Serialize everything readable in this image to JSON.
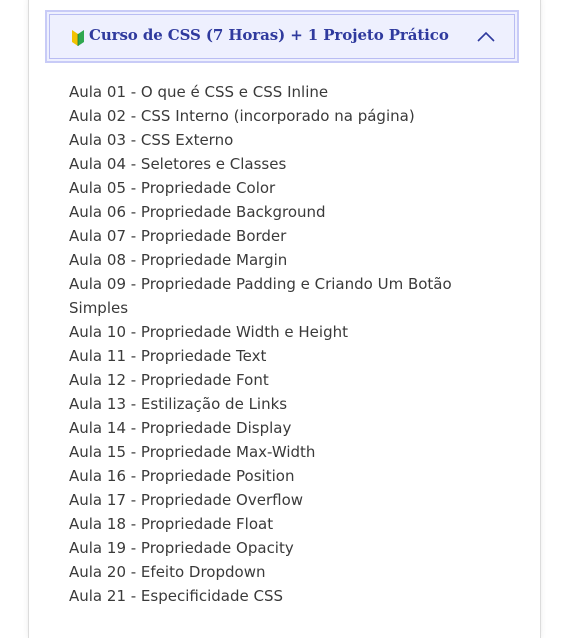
{
  "accordion": {
    "title": "Curso de CSS (7 Horas) + 1 Projeto Prático",
    "icon": "beginner-leaf-icon",
    "toggle_icon": "chevron-up-icon",
    "expanded": true,
    "colors": {
      "header_bg": "#eef0fe",
      "header_border": "#c8cbf7",
      "title": "#2f3a9e",
      "text": "#3a3a3a"
    }
  },
  "lessons": [
    "Aula 01 - O que é CSS e CSS Inline",
    "Aula 02 - CSS Interno (incorporado na página)",
    "Aula 03 - CSS Externo",
    "Aula 04 - Seletores e Classes",
    "Aula 05 - Propriedade Color",
    "Aula 06 - Propriedade Background",
    "Aula 07 - Propriedade Border",
    "Aula 08 - Propriedade Margin",
    "Aula 09 - Propriedade Padding e Criando Um Botão Simples",
    "Aula 10 - Propriedade Width e Height",
    "Aula 11 - Propriedade Text",
    "Aula 12 - Propriedade Font",
    "Aula 13 - Estilização de Links",
    "Aula 14 - Propriedade Display",
    "Aula 15 - Propriedade Max-Width",
    "Aula 16 - Propriedade Position",
    "Aula 17 - Propriedade Overflow",
    "Aula 18 - Propriedade Float",
    "Aula 19 - Propriedade Opacity",
    "Aula 20 - Efeito Dropdown",
    "Aula 21 - Especificidade CSS"
  ]
}
